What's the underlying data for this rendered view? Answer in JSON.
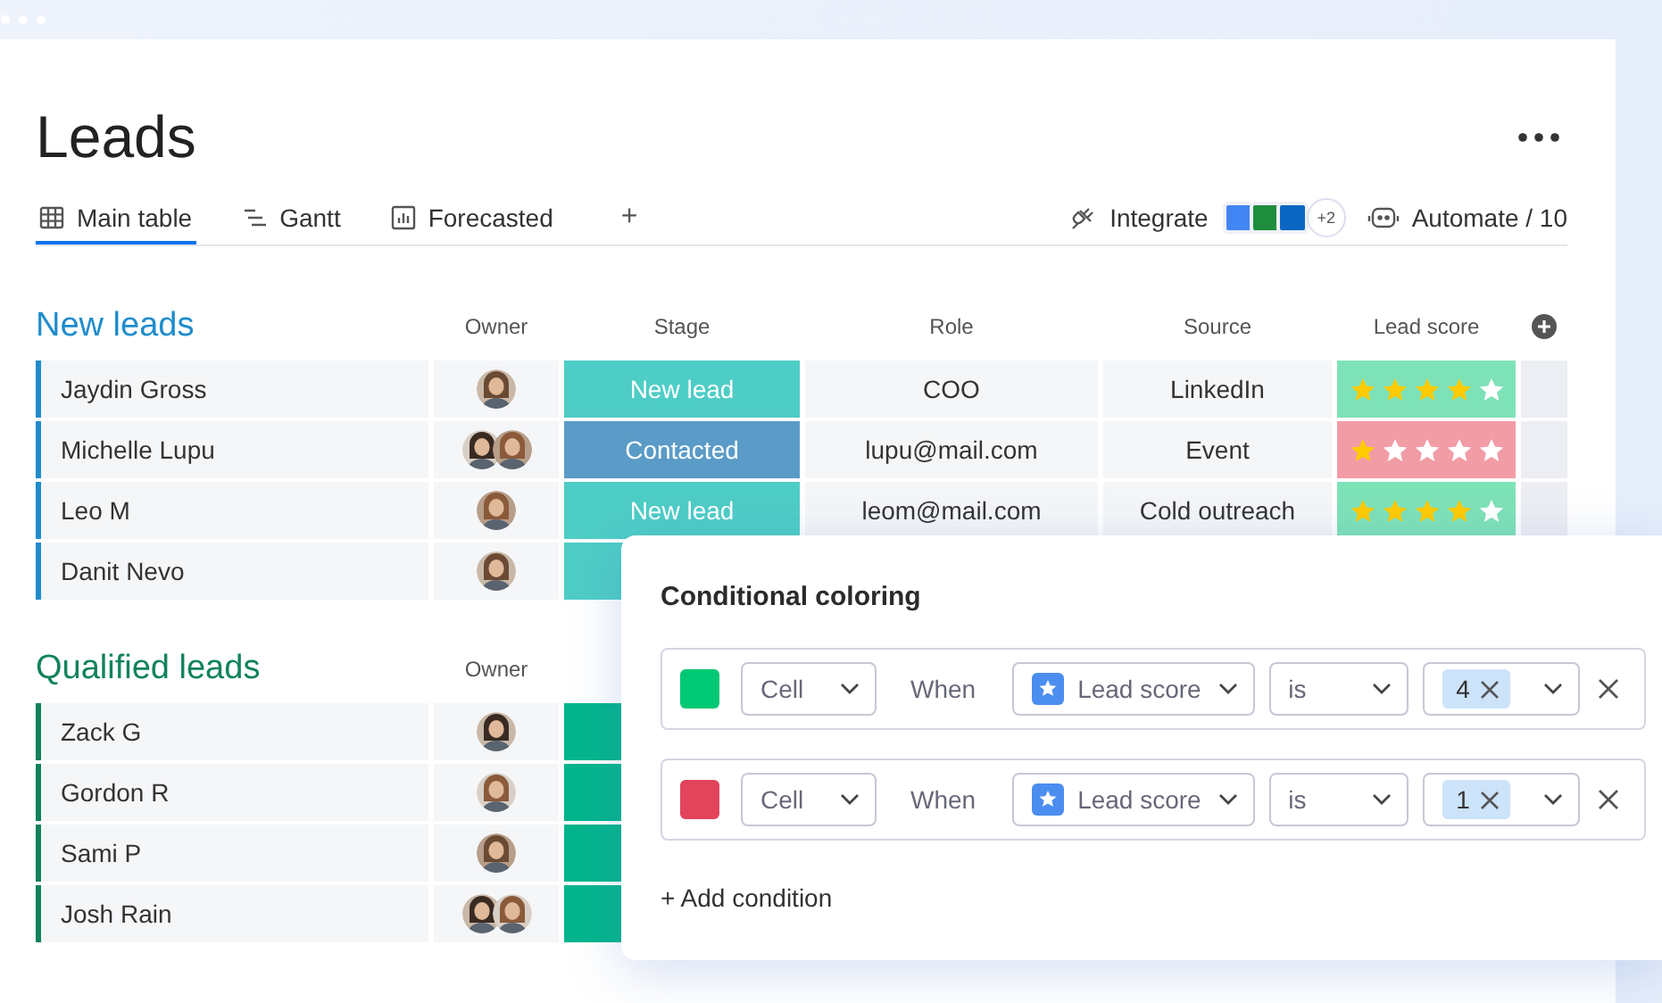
{
  "title": "Leads",
  "tabs": [
    {
      "label": "Main table",
      "kind": "table",
      "selected": true
    },
    {
      "label": "Gantt",
      "kind": "gantt",
      "selected": false
    },
    {
      "label": "Forecasted",
      "kind": "chart",
      "selected": false
    }
  ],
  "add_tab": "+",
  "integrate": {
    "label": "Integrate",
    "apps": [
      {
        "color": "#4285f4"
      },
      {
        "color": "#1e8e3e"
      },
      {
        "color": "#0a66c2"
      }
    ],
    "more": "+2"
  },
  "automate": {
    "label": "Automate / 10"
  },
  "groups": [
    {
      "title": "New leads",
      "color": "#1f8ccc",
      "columns": [
        "Owner",
        "Stage",
        "Role",
        "Source",
        "Lead score"
      ],
      "add_column_button": true,
      "rows": [
        {
          "name": "Jaydin Gross",
          "owners": [
            {
              "kind": "avatar"
            }
          ],
          "stage": {
            "label": "New lead",
            "color": "#4ecdc6"
          },
          "role": "COO",
          "source": "LinkedIn",
          "score": {
            "stars": 4,
            "color": "#7ee2b8"
          }
        },
        {
          "name": "Michelle Lupu",
          "owners": [
            {
              "kind": "avatar"
            },
            {
              "kind": "avatar"
            }
          ],
          "stage": {
            "label": "Contacted",
            "color": "#5a9bc7"
          },
          "role": "lupu@mail.com",
          "source": "Event",
          "score": {
            "stars": 1,
            "color": "#f29ca6"
          }
        },
        {
          "name": "Leo M",
          "owners": [
            {
              "kind": "avatar"
            }
          ],
          "stage": {
            "label": "New lead",
            "color": "#4ecdc6"
          },
          "role": "leom@mail.com",
          "source": "Cold outreach",
          "score": {
            "stars": 4,
            "color": "#7ee2b8"
          }
        },
        {
          "name": "Danit Nevo",
          "owners": [
            {
              "kind": "avatar"
            }
          ],
          "stage": {
            "color": "#4ecdc6"
          }
        }
      ]
    },
    {
      "title": "Qualified leads",
      "color": "#11835a",
      "columns": [
        "Owner"
      ],
      "rows": [
        {
          "name": "Zack G",
          "owners": [
            {
              "kind": "avatar"
            }
          ],
          "stage": {
            "color": "#03b58c"
          }
        },
        {
          "name": "Gordon R",
          "owners": [
            {
              "kind": "avatar"
            }
          ],
          "stage": {
            "color": "#03b58c"
          }
        },
        {
          "name": "Sami P",
          "owners": [
            {
              "kind": "avatar"
            }
          ],
          "stage": {
            "color": "#03b58c"
          }
        },
        {
          "name": "Josh Rain",
          "owners": [
            {
              "kind": "avatar"
            },
            {
              "kind": "avatar"
            }
          ],
          "stage": {
            "color": "#03b58c"
          }
        }
      ]
    }
  ],
  "conditional_coloring": {
    "title": "Conditional coloring",
    "rules": [
      {
        "color": "#00c875",
        "target": "Cell",
        "when": "When",
        "column": "Lead score",
        "operator": "is",
        "value": "4"
      },
      {
        "color": "#e2445c",
        "target": "Cell",
        "when": "When",
        "column": "Lead score",
        "operator": "is",
        "value": "1"
      }
    ],
    "add": "+ Add condition"
  }
}
